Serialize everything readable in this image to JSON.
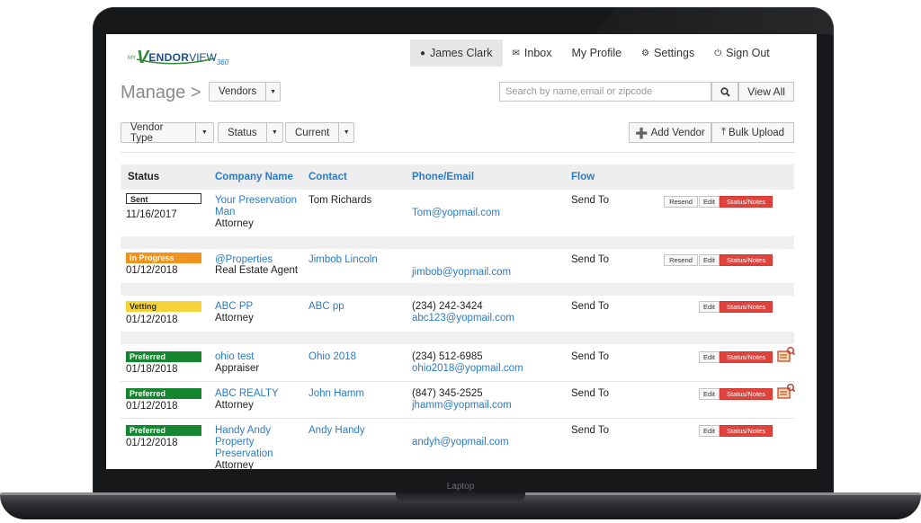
{
  "device_label": "Laptop",
  "logo": {
    "my": "MY",
    "v": "V",
    "endor": "ENDOR",
    "view": "VIEW",
    "n360": "360"
  },
  "nav": {
    "user": "James Clark",
    "inbox": "Inbox",
    "profile": "My Profile",
    "settings": "Settings",
    "signout": "Sign Out"
  },
  "manage": {
    "title": "Manage >",
    "scope": "Vendors",
    "search_placeholder": "Search by name,email or zipcode",
    "view_all": "View All"
  },
  "filters": {
    "vendor_type": "Vendor Type",
    "status": "Status",
    "current": "Current"
  },
  "actions": {
    "add_vendor": "Add Vendor",
    "bulk_upload": "Bulk Upload",
    "resend": "Resend",
    "edit": "Edit",
    "notes": "Status/Notes"
  },
  "table": {
    "headers": [
      "Status",
      "Company Name",
      "Contact",
      "Phone/Email",
      "Flow"
    ],
    "rows": [
      {
        "status": "Sent",
        "date": "11/16/2017",
        "company": "Your Preservation",
        "company2": "Man",
        "type": "Attorney",
        "contact": "Tom Richards",
        "phone": "",
        "email": "Tom@yopmail.com",
        "flow": "Send To"
      },
      {
        "status": "In Progress",
        "date": "01/12/2018",
        "company": "@Properties",
        "company2": "",
        "type": "Real Estate Agent",
        "contact": "Jimbob Lincoln",
        "phone": "",
        "email": "jimbob@yopmail.com",
        "flow": "Send To"
      },
      {
        "status": "Vetting",
        "date": "01/12/2018",
        "company": "ABC PP",
        "company2": "",
        "type": "Attorney",
        "contact": "ABC pp",
        "phone": "(234) 242-3424",
        "email": "abc123@yopmail.com",
        "flow": "Send To"
      },
      {
        "status": "Preferred",
        "date": "01/18/2018",
        "company": "ohio test",
        "company2": "",
        "type": "Appraiser",
        "contact": "Ohio 2018",
        "phone": "(234) 512-6985",
        "email": "ohio2018@yopmail.com",
        "flow": "Send To"
      },
      {
        "status": "Preferred",
        "date": "01/12/2018",
        "company": "ABC REALTY",
        "company2": "",
        "type": "Attorney",
        "contact": "John Hamm",
        "phone": "(847) 345-2525",
        "email": "jhamm@yopmail.com",
        "flow": "Send To"
      },
      {
        "status": "Preferred",
        "date": "01/12/2018",
        "company": "Handy Andy",
        "company2": "Property",
        "company3": "Preservation",
        "type": "Attorney",
        "contact": "Andy Handy",
        "phone": "",
        "email": "andyh@yopmail.com",
        "flow": "Send To"
      }
    ]
  },
  "colors": {
    "link": "#2a7bc6",
    "sent": "#ffffff",
    "in_progress": "#f0921e",
    "vetting": "#f5d43a",
    "preferred": "#15862f",
    "notes_button": "#e0433c"
  }
}
